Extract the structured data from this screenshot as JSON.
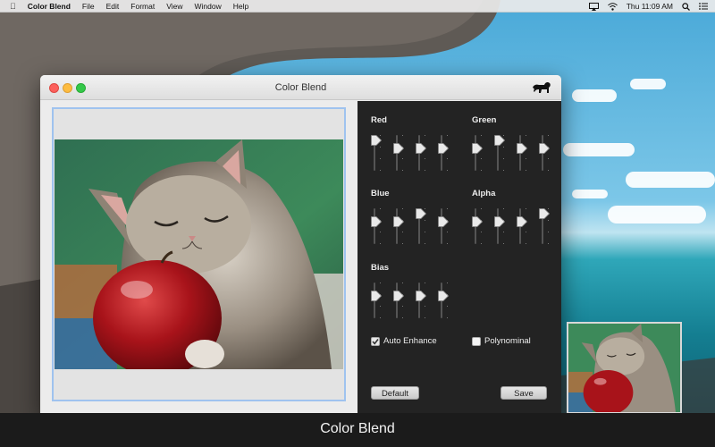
{
  "menubar": {
    "app_name": "Color Blend",
    "items": [
      "File",
      "Edit",
      "Format",
      "View",
      "Window",
      "Help"
    ],
    "clock": "Thu 11:09 AM"
  },
  "window": {
    "title": "Color Blend"
  },
  "controls": {
    "groups": {
      "red": {
        "label": "Red",
        "levels": [
          1.0,
          0.67,
          0.67,
          0.67
        ]
      },
      "green": {
        "label": "Green",
        "levels": [
          0.67,
          1.0,
          0.67,
          0.67
        ]
      },
      "blue": {
        "label": "Blue",
        "levels": [
          0.67,
          0.67,
          1.0,
          0.67
        ]
      },
      "alpha": {
        "label": "Alpha",
        "levels": [
          0.67,
          0.67,
          0.67,
          1.0
        ]
      },
      "bias": {
        "label": "Bias",
        "levels": [
          0.67,
          0.67,
          0.67,
          0.67
        ]
      }
    },
    "auto_enhance": {
      "label": "Auto Enhance",
      "checked": true
    },
    "polynominal": {
      "label": "Polynominal",
      "checked": false
    },
    "default_button": "Default",
    "save_button": "Save"
  },
  "caption": "Color Blend",
  "colors": {
    "panel": "#232323",
    "selection": "#9fc3ef",
    "close": "#fc605c",
    "minimize": "#fdbc40",
    "zoom": "#34c84a"
  }
}
